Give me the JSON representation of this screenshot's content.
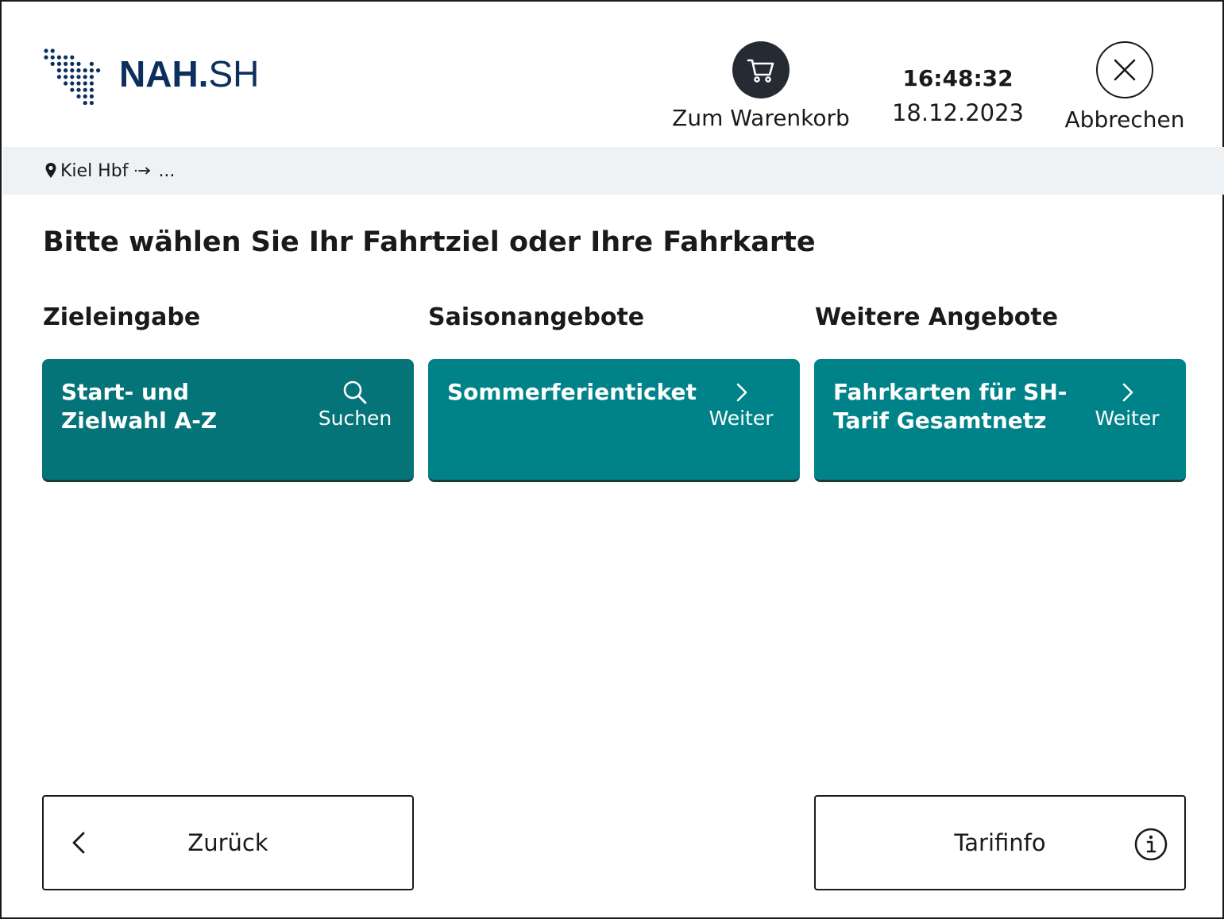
{
  "header": {
    "logo": {
      "bold": "NAH",
      "dot": ".",
      "thin": "SH",
      "icon": "map-dots-logo"
    },
    "cart": {
      "label": "Zum Warenkorb",
      "icon": "shopping-cart-icon"
    },
    "clock": {
      "time": "16:48:32",
      "date": "18.12.2023"
    },
    "cancel": {
      "label": "Abbrechen",
      "icon": "close-icon"
    }
  },
  "breadcrumb": {
    "from": "Kiel Hbf",
    "to": "...",
    "icon": "location-pin-icon"
  },
  "page_title": "Bitte wählen Sie Ihr Fahrtziel oder Ihre Fahrkarte",
  "columns": [
    {
      "heading": "Zieleingabe",
      "tile_title": "Start- und Zielwahl A-Z",
      "action": "Suchen",
      "icon": "search-icon"
    },
    {
      "heading": "Saisonangebote",
      "tile_title": "Sommerferienticket",
      "action": "Weiter",
      "icon": "chevron-right-icon"
    },
    {
      "heading": "Weitere Angebote",
      "tile_title": "Fahrkarten für SH-Tarif Gesamtnetz",
      "action": "Weiter",
      "icon": "chevron-right-icon"
    }
  ],
  "footer": {
    "back": {
      "label": "Zurück",
      "icon": "chevron-left-icon"
    },
    "tarif": {
      "label": "Tarifinfo",
      "icon": "info-icon"
    }
  },
  "colors": {
    "brand": "#0d2f5e",
    "tile_dark": "#047479",
    "tile_teal": "#008289",
    "crumb_bg": "#eef2f5"
  }
}
